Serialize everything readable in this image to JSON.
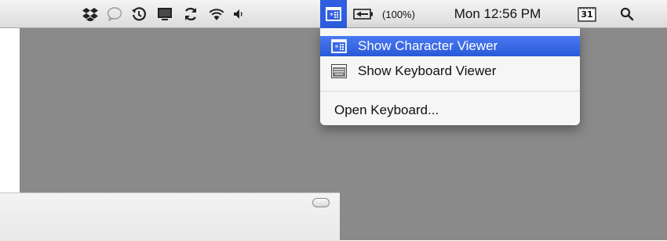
{
  "menubar": {
    "icons": [
      "dropbox-icon",
      "speech-bubble-icon",
      "time-machine-icon",
      "display-icon",
      "sync-icon",
      "wifi-icon",
      "volume-icon",
      "character-viewer-icon",
      "battery-icon",
      "calendar-icon",
      "spotlight-icon"
    ],
    "battery_percent": "(100%)",
    "clock": "Mon 12:56 PM",
    "calendar_day": "31",
    "input_menu_highlight": "#2f5fe0"
  },
  "dropdown": {
    "items": [
      {
        "label": "Show Character Viewer",
        "icon": "character-viewer-icon",
        "selected": true
      },
      {
        "label": "Show Keyboard Viewer",
        "icon": "keyboard-viewer-icon",
        "selected": false
      },
      {
        "label": "Open Keyboard...",
        "icon": "",
        "selected": false
      }
    ],
    "selected_color": "#2a59d8"
  },
  "colors": {
    "desktop": "#8a8a8a",
    "menubar": "#e6e6e6"
  }
}
